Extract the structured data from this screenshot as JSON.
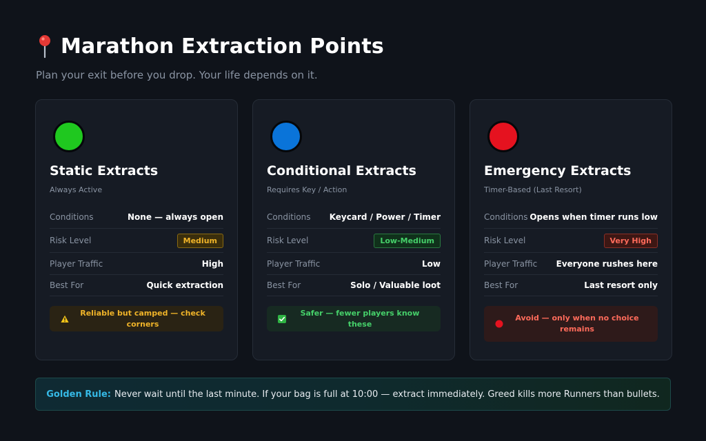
{
  "header": {
    "title": "Marathon Extraction Points",
    "subtitle": "Plan your exit before you drop. Your life depends on it.",
    "icon": "map-pin-icon"
  },
  "cards": [
    {
      "id": "static",
      "dot_color": "#1fc81f",
      "title": "Static Extracts",
      "subtitle": "Always Active",
      "rows": [
        {
          "label": "Conditions",
          "value": "None — always open"
        },
        {
          "label": "Risk Level",
          "value": "Medium",
          "badge": "amber"
        },
        {
          "label": "Player Traffic",
          "value": "High"
        },
        {
          "label": "Best For",
          "value": "Quick extraction"
        }
      ],
      "note": {
        "icon": "warning-icon",
        "text": "Reliable but camped — check corners",
        "tone": "amber"
      }
    },
    {
      "id": "conditional",
      "dot_color": "#0a74d9",
      "title": "Conditional Extracts",
      "subtitle": "Requires Key / Action",
      "rows": [
        {
          "label": "Conditions",
          "value": "Keycard / Power / Timer"
        },
        {
          "label": "Risk Level",
          "value": "Low-Medium",
          "badge": "green"
        },
        {
          "label": "Player Traffic",
          "value": "Low"
        },
        {
          "label": "Best For",
          "value": "Solo / Valuable loot"
        }
      ],
      "note": {
        "icon": "check-box-icon",
        "text": "Safer — fewer players know these",
        "tone": "green"
      }
    },
    {
      "id": "emergency",
      "dot_color": "#e5121f",
      "title": "Emergency Extracts",
      "subtitle": "Timer-Based (Last Resort)",
      "rows": [
        {
          "label": "Conditions",
          "value": "Opens when timer runs low"
        },
        {
          "label": "Risk Level",
          "value": "Very High",
          "badge": "red"
        },
        {
          "label": "Player Traffic",
          "value": "Everyone rushes here"
        },
        {
          "label": "Best For",
          "value": "Last resort only"
        }
      ],
      "note": {
        "icon": "red-circle-icon",
        "text": "Avoid — only when no choice remains",
        "tone": "red"
      }
    }
  ],
  "rule": {
    "label": "Golden Rule:",
    "text": "Never wait until the last minute. If your bag is full at 10:00 — extract immediately. Greed kills more Runners than bullets."
  },
  "colors": {
    "accent_blue": "#35b9e6",
    "amber": "#f0b429",
    "green": "#46d06a",
    "red": "#ff6b5b"
  }
}
